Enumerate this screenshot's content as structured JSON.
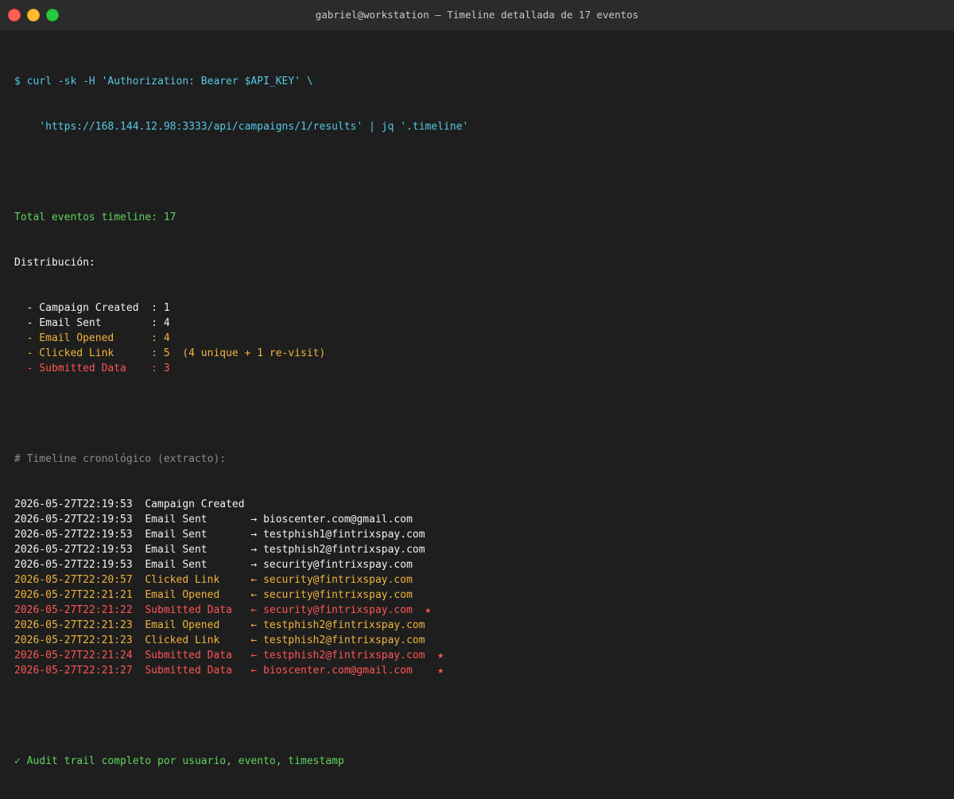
{
  "window": {
    "title": "gabriel@workstation — Timeline detallada de 17 eventos"
  },
  "terminal": {
    "command_line1": "$ curl -sk -H 'Authorization: Bearer $API_KEY' \\",
    "command_line2": "    'https://168.144.12.98:3333/api/campaigns/1/results' | jq '.timeline'",
    "total": "Total eventos timeline: 17",
    "distribution_header": "Distribución:",
    "distribution": [
      {
        "text": "  - Campaign Created  : 1",
        "color": "white"
      },
      {
        "text": "  - Email Sent        : 4",
        "color": "white"
      },
      {
        "text": "  - Email Opened      : 4",
        "color": "orange"
      },
      {
        "text": "  - Clicked Link      : 5  (4 unique + 1 re-visit)",
        "color": "orange"
      },
      {
        "text": "  - Submitted Data    : 3",
        "color": "red"
      }
    ],
    "timeline_comment": "# Timeline cronológico (extracto):",
    "timeline": [
      {
        "text": "2026-05-27T22:19:53  Campaign Created",
        "color": "white"
      },
      {
        "text": "2026-05-27T22:19:53  Email Sent       → bioscenter.com@gmail.com",
        "color": "white"
      },
      {
        "text": "2026-05-27T22:19:53  Email Sent       → testphish1@fintrixspay.com",
        "color": "white"
      },
      {
        "text": "2026-05-27T22:19:53  Email Sent       → testphish2@fintrixspay.com",
        "color": "white"
      },
      {
        "text": "2026-05-27T22:19:53  Email Sent       → security@fintrixspay.com",
        "color": "white"
      },
      {
        "text": "2026-05-27T22:20:57  Clicked Link     ← security@fintrixspay.com",
        "color": "orange"
      },
      {
        "text": "2026-05-27T22:21:21  Email Opened     ← security@fintrixspay.com",
        "color": "orange"
      },
      {
        "text": "2026-05-27T22:21:22  Submitted Data   ← security@fintrixspay.com  ★",
        "color": "red"
      },
      {
        "text": "2026-05-27T22:21:23  Email Opened     ← testphish2@fintrixspay.com",
        "color": "orange"
      },
      {
        "text": "2026-05-27T22:21:23  Clicked Link     ← testphish2@fintrixspay.com",
        "color": "orange"
      },
      {
        "text": "2026-05-27T22:21:24  Submitted Data   ← testphish2@fintrixspay.com  ★",
        "color": "red"
      },
      {
        "text": "2026-05-27T22:21:27  Submitted Data   ← bioscenter.com@gmail.com    ★",
        "color": "red"
      }
    ],
    "footer": "✓ Audit trail completo por usuario, evento, timestamp"
  },
  "colors": {
    "white": "#f2f2f2",
    "cyan": "#56c8e6",
    "green": "#5fd35f",
    "gray": "#8c8c8c",
    "orange": "#f0b43c",
    "red": "#ff5555"
  }
}
